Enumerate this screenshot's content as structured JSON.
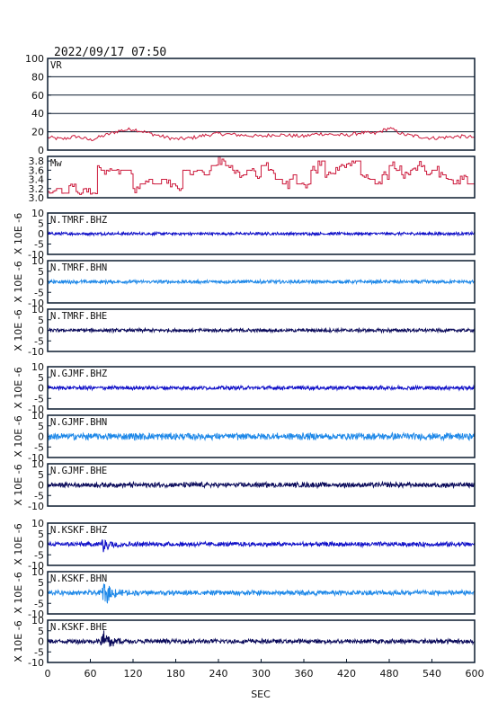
{
  "header": {
    "timestamp": "2022/09/17 07:50"
  },
  "x_axis": {
    "label": "SEC",
    "range": [
      0,
      600
    ],
    "ticks": [
      0,
      60,
      120,
      180,
      240,
      300,
      360,
      420,
      480,
      540,
      600
    ]
  },
  "colors": {
    "vr": "#cc1a3c",
    "mw": "#cc1a3c",
    "bhz": "#1010c8",
    "bhn": "#1e88e8",
    "bhe": "#0a0a5a",
    "frame": "#0a1a2e"
  },
  "chart_data": [
    {
      "type": "line",
      "panel": "vr",
      "label": "VR",
      "ylim": [
        0,
        100
      ],
      "yticks": [
        0,
        20,
        40,
        60,
        80,
        100
      ],
      "grid": true,
      "x": [
        0,
        20,
        40,
        60,
        80,
        100,
        120,
        140,
        160,
        180,
        200,
        220,
        240,
        260,
        280,
        300,
        320,
        340,
        360,
        380,
        400,
        420,
        440,
        460,
        480,
        500,
        520,
        540,
        560,
        580,
        600
      ],
      "values": [
        14,
        12,
        15,
        11,
        16,
        21,
        23,
        19,
        15,
        12,
        13,
        16,
        18,
        17,
        16,
        15,
        17,
        16,
        15,
        18,
        17,
        16,
        19,
        18,
        24,
        17,
        15,
        13,
        14,
        15,
        14
      ]
    },
    {
      "type": "line",
      "panel": "mw",
      "label": "Mw",
      "ylim": [
        3.0,
        3.9
      ],
      "yticks": [
        3.0,
        3.2,
        3.4,
        3.6,
        3.8
      ],
      "x": [
        0,
        10,
        20,
        30,
        40,
        50,
        60,
        70,
        80,
        90,
        100,
        110,
        120,
        130,
        140,
        150,
        160,
        170,
        180,
        190,
        200,
        210,
        220,
        230,
        240,
        250,
        260,
        270,
        280,
        290,
        300,
        310,
        320,
        330,
        340,
        350,
        360,
        370,
        380,
        390,
        400,
        410,
        420,
        430,
        440,
        450,
        460,
        470,
        480,
        490,
        500,
        510,
        520,
        530,
        540,
        550,
        560,
        570,
        580,
        590,
        600
      ],
      "values": [
        3.1,
        3.2,
        3.1,
        3.2,
        3.1,
        3.2,
        3.1,
        3.6,
        3.6,
        3.6,
        3.6,
        3.6,
        3.2,
        3.3,
        3.4,
        3.3,
        3.4,
        3.3,
        3.2,
        3.6,
        3.5,
        3.6,
        3.5,
        3.7,
        3.8,
        3.7,
        3.6,
        3.5,
        3.6,
        3.5,
        3.7,
        3.6,
        3.4,
        3.3,
        3.5,
        3.3,
        3.3,
        3.6,
        3.8,
        3.5,
        3.6,
        3.7,
        3.7,
        3.8,
        3.5,
        3.4,
        3.3,
        3.5,
        3.7,
        3.6,
        3.5,
        3.6,
        3.7,
        3.5,
        3.6,
        3.5,
        3.4,
        3.3,
        3.4,
        3.3,
        3.2
      ]
    },
    {
      "type": "line",
      "panel": "wave",
      "label": "N.TMRF.BHZ",
      "channel": "bhz",
      "ylim": [
        -10,
        10
      ],
      "yticks": [
        10,
        5,
        0,
        -5,
        -10
      ],
      "ylabel": "X 10E -6",
      "noise_amplitude": 0.6,
      "event": null
    },
    {
      "type": "line",
      "panel": "wave",
      "label": "N.TMRF.BHN",
      "channel": "bhn",
      "ylim": [
        -10,
        10
      ],
      "yticks": [
        10,
        5,
        0,
        -5,
        -10
      ],
      "ylabel": "X 10E -6",
      "noise_amplitude": 0.7,
      "event": null
    },
    {
      "type": "line",
      "panel": "wave",
      "label": "N.TMRF.BHE",
      "channel": "bhe",
      "ylim": [
        -10,
        10
      ],
      "yticks": [
        10,
        5,
        0,
        -5,
        -10
      ],
      "ylabel": "X 10E -6",
      "noise_amplitude": 0.7,
      "event": null
    },
    {
      "type": "line",
      "panel": "wave",
      "label": "N.GJMF.BHZ",
      "channel": "bhz",
      "ylim": [
        -10,
        10
      ],
      "yticks": [
        10,
        5,
        0,
        -5,
        -10
      ],
      "ylabel": "X 10E -6",
      "noise_amplitude": 0.8,
      "event": null
    },
    {
      "type": "line",
      "panel": "wave",
      "label": "N.GJMF.BHN",
      "channel": "bhn",
      "ylim": [
        -10,
        10
      ],
      "yticks": [
        10,
        5,
        0,
        -5,
        -10
      ],
      "ylabel": "X 10E -6",
      "noise_amplitude": 1.4,
      "event": null
    },
    {
      "type": "line",
      "panel": "wave",
      "label": "N.GJMF.BHE",
      "channel": "bhe",
      "ylim": [
        -10,
        10
      ],
      "yticks": [
        10,
        5,
        0,
        -5,
        -10
      ],
      "ylabel": "X 10E -6",
      "noise_amplitude": 1.0,
      "event": null
    },
    {
      "type": "line",
      "panel": "wave",
      "label": "N.KSKF.BHZ",
      "channel": "bhz",
      "ylim": [
        -10,
        10
      ],
      "yticks": [
        10,
        5,
        0,
        -5,
        -10
      ],
      "ylabel": "X 10E -6",
      "noise_amplitude": 0.9,
      "event": {
        "onset": 75,
        "peak_amplitude": 4.5,
        "decay": 14
      }
    },
    {
      "type": "line",
      "panel": "wave",
      "label": "N.KSKF.BHN",
      "channel": "bhn",
      "ylim": [
        -10,
        10
      ],
      "yticks": [
        10,
        5,
        0,
        -5,
        -10
      ],
      "ylabel": "X 10E -6",
      "noise_amplitude": 1.0,
      "event": {
        "onset": 76,
        "peak_amplitude": 6.5,
        "decay": 15
      }
    },
    {
      "type": "line",
      "panel": "wave",
      "label": "N.KSKF.BHE",
      "channel": "bhe",
      "ylim": [
        -10,
        10
      ],
      "yticks": [
        10,
        5,
        0,
        -5,
        -10
      ],
      "ylabel": "X 10E -6",
      "noise_amplitude": 0.9,
      "event": {
        "onset": 74,
        "peak_amplitude": 7.5,
        "decay": 14
      }
    }
  ]
}
